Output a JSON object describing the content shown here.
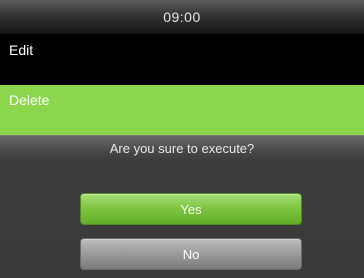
{
  "status_bar": {
    "time": "09:00"
  },
  "menu": {
    "items": [
      {
        "label": "Edit",
        "selected": false
      },
      {
        "label": "Delete",
        "selected": true
      }
    ]
  },
  "dialog": {
    "message": "Are you sure to execute?",
    "confirm_label": "Yes",
    "cancel_label": "No"
  },
  "colors": {
    "selection_green": "#8cd64e",
    "confirm_button": "#7cc43f",
    "cancel_button": "#9a9a9a",
    "background": "#000000"
  }
}
